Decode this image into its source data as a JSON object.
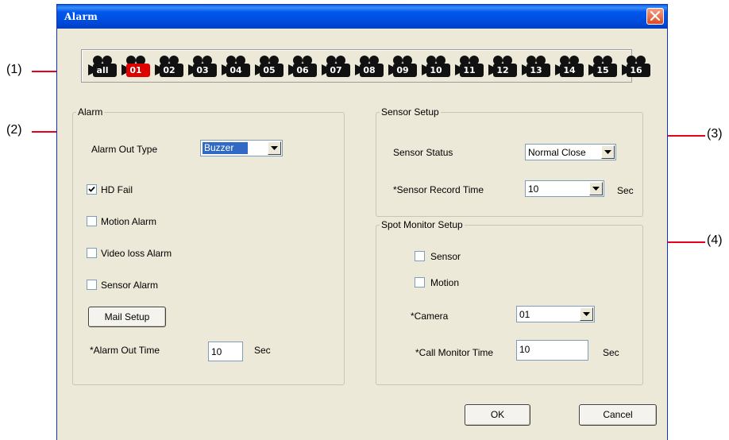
{
  "callouts": {
    "c1": "(1)",
    "c2": "(2)",
    "c3": "(3)",
    "c4": "(4)"
  },
  "window": {
    "title": "Alarm"
  },
  "cameras": [
    {
      "label": "all",
      "selected": false
    },
    {
      "label": "01",
      "selected": true
    },
    {
      "label": "02",
      "selected": false
    },
    {
      "label": "03",
      "selected": false
    },
    {
      "label": "04",
      "selected": false
    },
    {
      "label": "05",
      "selected": false
    },
    {
      "label": "06",
      "selected": false
    },
    {
      "label": "07",
      "selected": false
    },
    {
      "label": "08",
      "selected": false
    },
    {
      "label": "09",
      "selected": false
    },
    {
      "label": "10",
      "selected": false
    },
    {
      "label": "11",
      "selected": false
    },
    {
      "label": "12",
      "selected": false
    },
    {
      "label": "13",
      "selected": false
    },
    {
      "label": "14",
      "selected": false
    },
    {
      "label": "15",
      "selected": false
    },
    {
      "label": "16",
      "selected": false
    }
  ],
  "alarm": {
    "legend": "Alarm",
    "out_type_label": "Alarm Out Type",
    "out_type_value": "Buzzer",
    "hd_fail": {
      "label": "HD Fail",
      "checked": true
    },
    "motion": {
      "label": "Motion Alarm",
      "checked": false
    },
    "video_loss": {
      "label": "Video loss Alarm",
      "checked": false
    },
    "sensor": {
      "label": "Sensor Alarm",
      "checked": false
    },
    "mail_setup": "Mail Setup",
    "out_time_label": "*Alarm Out Time",
    "out_time_value": "10",
    "out_time_unit": "Sec"
  },
  "sensor_setup": {
    "legend": "Sensor Setup",
    "status_label": "Sensor Status",
    "status_value": "Normal Close",
    "record_label": "*Sensor Record Time",
    "record_value": "10",
    "record_unit": "Sec"
  },
  "spot_monitor": {
    "legend": "Spot Monitor Setup",
    "sensor": {
      "label": "Sensor",
      "checked": false
    },
    "motion": {
      "label": "Motion",
      "checked": false
    },
    "camera_label": "*Camera",
    "camera_value": "01",
    "call_time_label": "*Call Monitor Time",
    "call_time_value": "10",
    "call_time_unit": "Sec"
  },
  "buttons": {
    "ok": "OK",
    "cancel": "Cancel"
  },
  "colors": {
    "callout_line": "#e8001c",
    "selected_camera": "#e00000",
    "camera": "#111111"
  }
}
